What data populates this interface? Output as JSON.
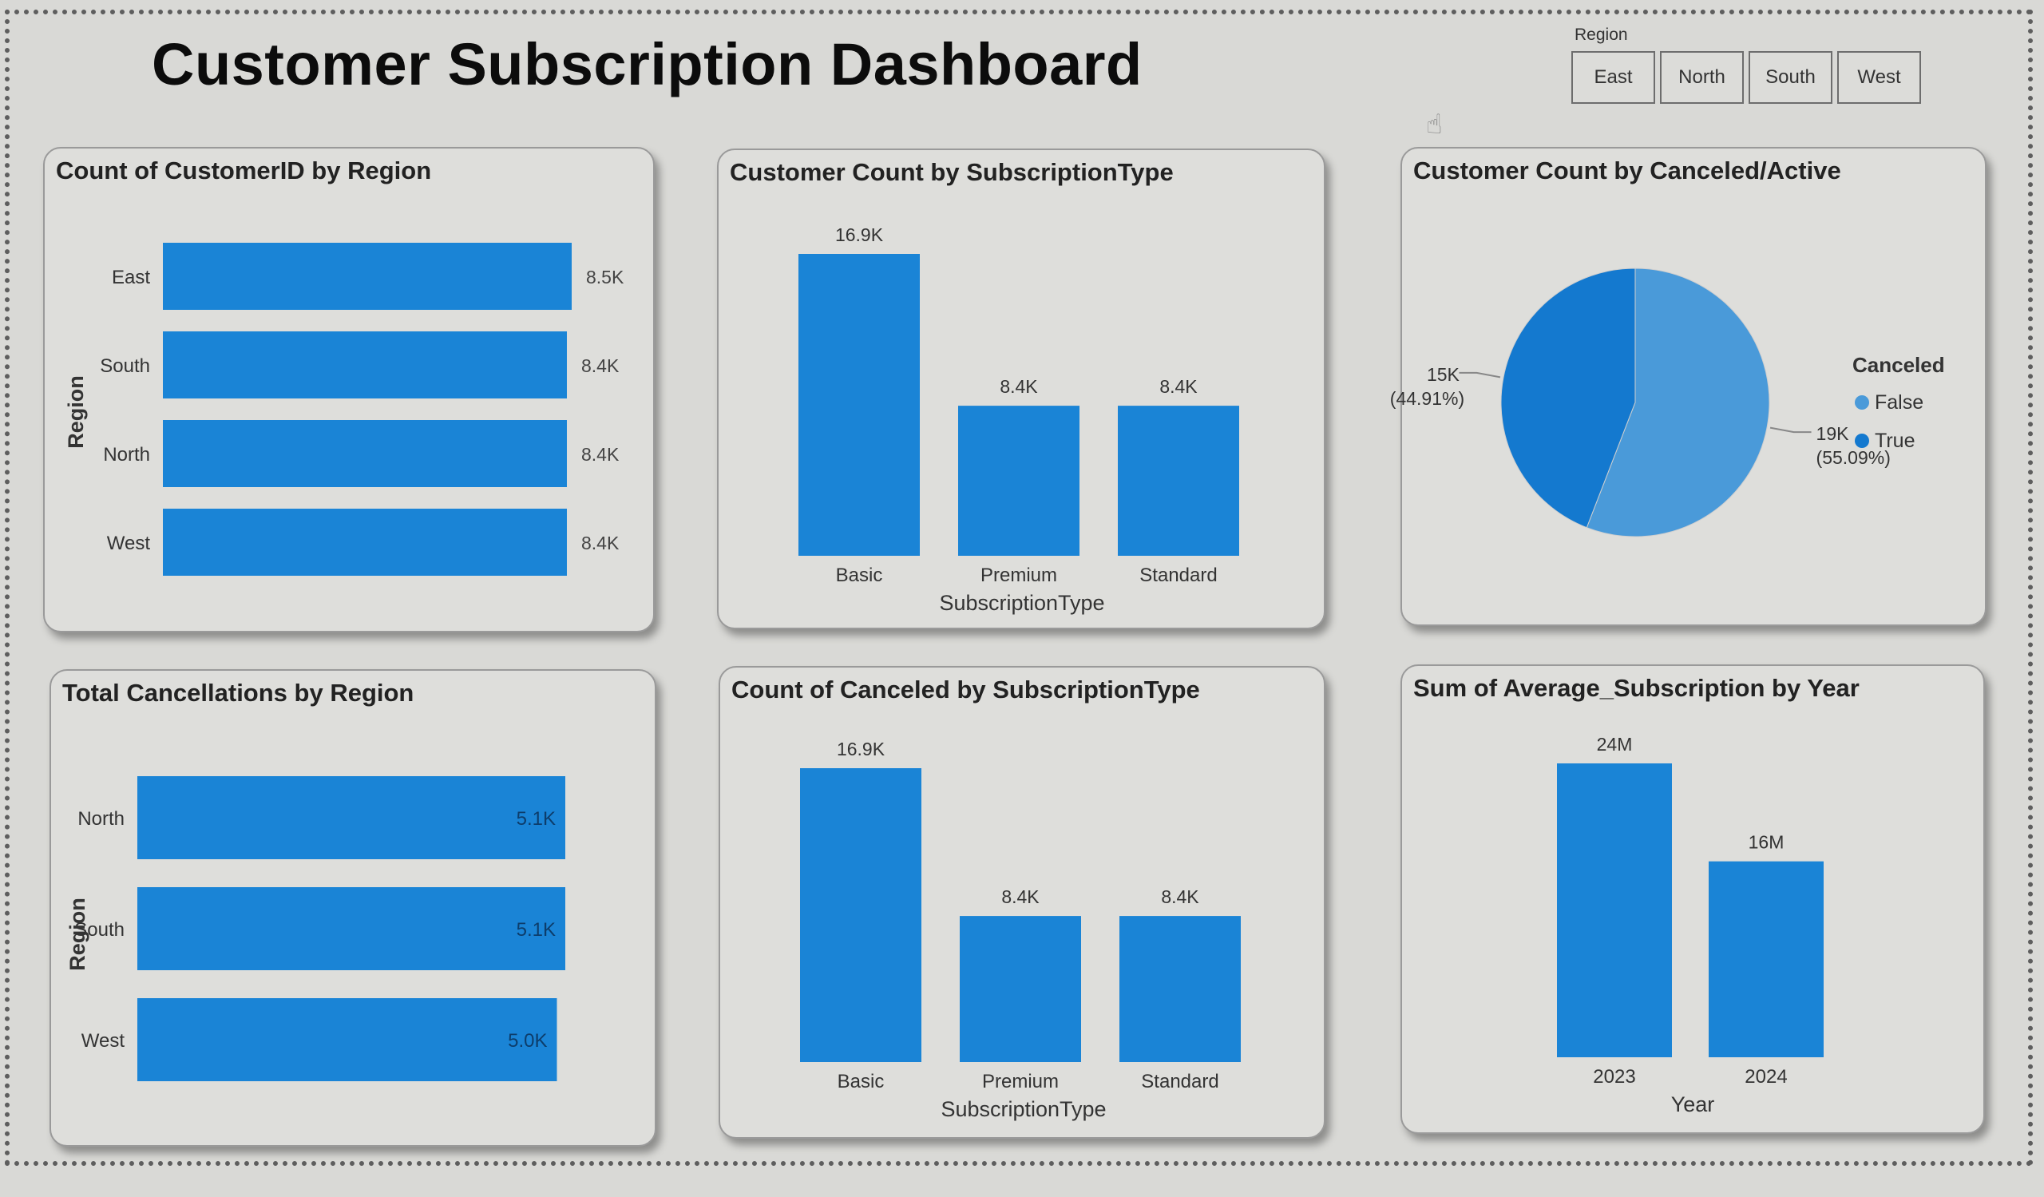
{
  "page_title": "Customer Subscription Dashboard",
  "slicer": {
    "title": "Region",
    "options": [
      "East",
      "North",
      "South",
      "West"
    ]
  },
  "colors": {
    "bar": "#1a84d6",
    "pie_true": "#1479cf",
    "pie_false": "#4a9ad9",
    "background": "#d9d9d6"
  },
  "cards": {
    "count_by_region": {
      "title": "Count of CustomerID by Region"
    },
    "count_by_subscription": {
      "title": "Customer Count by SubscriptionType"
    },
    "count_by_canceled": {
      "title": "Customer Count by Canceled/Active"
    },
    "cancellations_by_region": {
      "title": "Total Cancellations by Region"
    },
    "canceled_by_subscription": {
      "title": "Count of Canceled by SubscriptionType"
    },
    "avg_subscription_by_year": {
      "title": "Sum of Average_Subscription by Year"
    }
  },
  "chart_data": [
    {
      "type": "bar",
      "orientation": "horizontal",
      "title": "Count of CustomerID by Region",
      "categories": [
        "East",
        "South",
        "North",
        "West"
      ],
      "values": [
        8500,
        8400,
        8400,
        8400
      ],
      "data_labels": [
        "8.5K",
        "8.4K",
        "8.4K",
        "8.4K"
      ],
      "xlabel": "",
      "ylabel": "Region",
      "xlim": [
        0,
        8500
      ],
      "grid": false,
      "label_position": "outside"
    },
    {
      "type": "bar",
      "orientation": "vertical",
      "title": "Customer Count by SubscriptionType",
      "categories": [
        "Basic",
        "Premium",
        "Standard"
      ],
      "values": [
        16900,
        8400,
        8400
      ],
      "data_labels": [
        "16.9K",
        "8.4K",
        "8.4K"
      ],
      "xlabel": "SubscriptionType",
      "ylabel": "",
      "ylim": [
        0,
        16900
      ],
      "grid": false
    },
    {
      "type": "pie",
      "title": "Customer Count by Canceled/Active",
      "legend_title": "Canceled",
      "legend_position": "right",
      "slices": [
        {
          "name": "False",
          "value": 19000,
          "label": "19K",
          "percent_label": "(55.09%)",
          "color": "#4a9ad9"
        },
        {
          "name": "True",
          "value": 15000,
          "label": "15K",
          "percent_label": "(44.91%)",
          "color": "#1479cf"
        }
      ],
      "legend": [
        "False",
        "True"
      ]
    },
    {
      "type": "bar",
      "orientation": "horizontal",
      "title": "Total Cancellations by Region",
      "categories": [
        "North",
        "South",
        "West"
      ],
      "values": [
        5100,
        5100,
        5000
      ],
      "data_labels": [
        "5.1K",
        "5.1K",
        "5.0K"
      ],
      "xlabel": "",
      "ylabel": "Region",
      "xlim": [
        0,
        5100
      ],
      "grid": false,
      "label_position": "inside-end"
    },
    {
      "type": "bar",
      "orientation": "vertical",
      "title": "Count of Canceled by SubscriptionType",
      "categories": [
        "Basic",
        "Premium",
        "Standard"
      ],
      "values": [
        16900,
        8400,
        8400
      ],
      "data_labels": [
        "16.9K",
        "8.4K",
        "8.4K"
      ],
      "xlabel": "SubscriptionType",
      "ylabel": "",
      "ylim": [
        0,
        16900
      ],
      "grid": false
    },
    {
      "type": "bar",
      "orientation": "vertical",
      "title": "Sum of Average_Subscription by Year",
      "categories": [
        "2023",
        "2024"
      ],
      "values": [
        24000000,
        16000000
      ],
      "data_labels": [
        "24M",
        "16M"
      ],
      "xlabel": "Year",
      "ylabel": "",
      "ylim": [
        0,
        24000000
      ],
      "grid": false
    }
  ]
}
